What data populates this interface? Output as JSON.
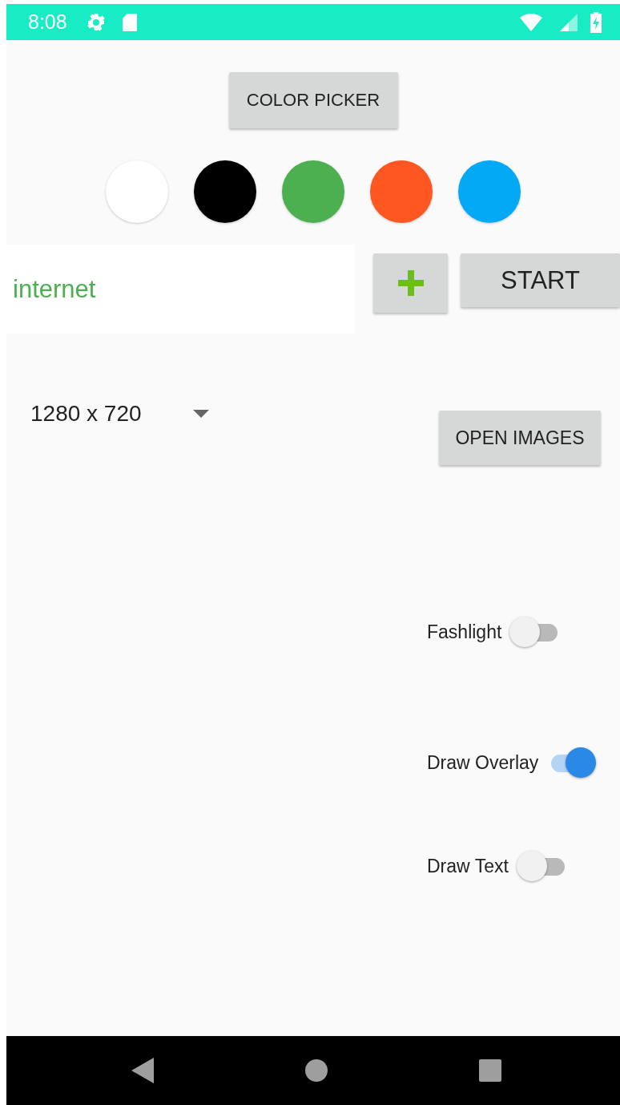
{
  "status_bar": {
    "time": "8:08"
  },
  "color_picker_button": {
    "label": "COLOR PICKER"
  },
  "swatches": [
    {
      "color": "#ffffff"
    },
    {
      "color": "#000000"
    },
    {
      "color": "#4caf50"
    },
    {
      "color": "#ff5722"
    },
    {
      "color": "#03a9f4"
    }
  ],
  "text_field": {
    "value": "internet"
  },
  "start_button": {
    "label": "START"
  },
  "resolution_spinner": {
    "value": "1280 x 720"
  },
  "open_images_button": {
    "label": "OPEN IMAGES"
  },
  "switches": [
    {
      "label": "Fashlight",
      "on": false
    },
    {
      "label": "Draw Overlay",
      "on": true
    },
    {
      "label": "Draw Text",
      "on": false
    }
  ]
}
